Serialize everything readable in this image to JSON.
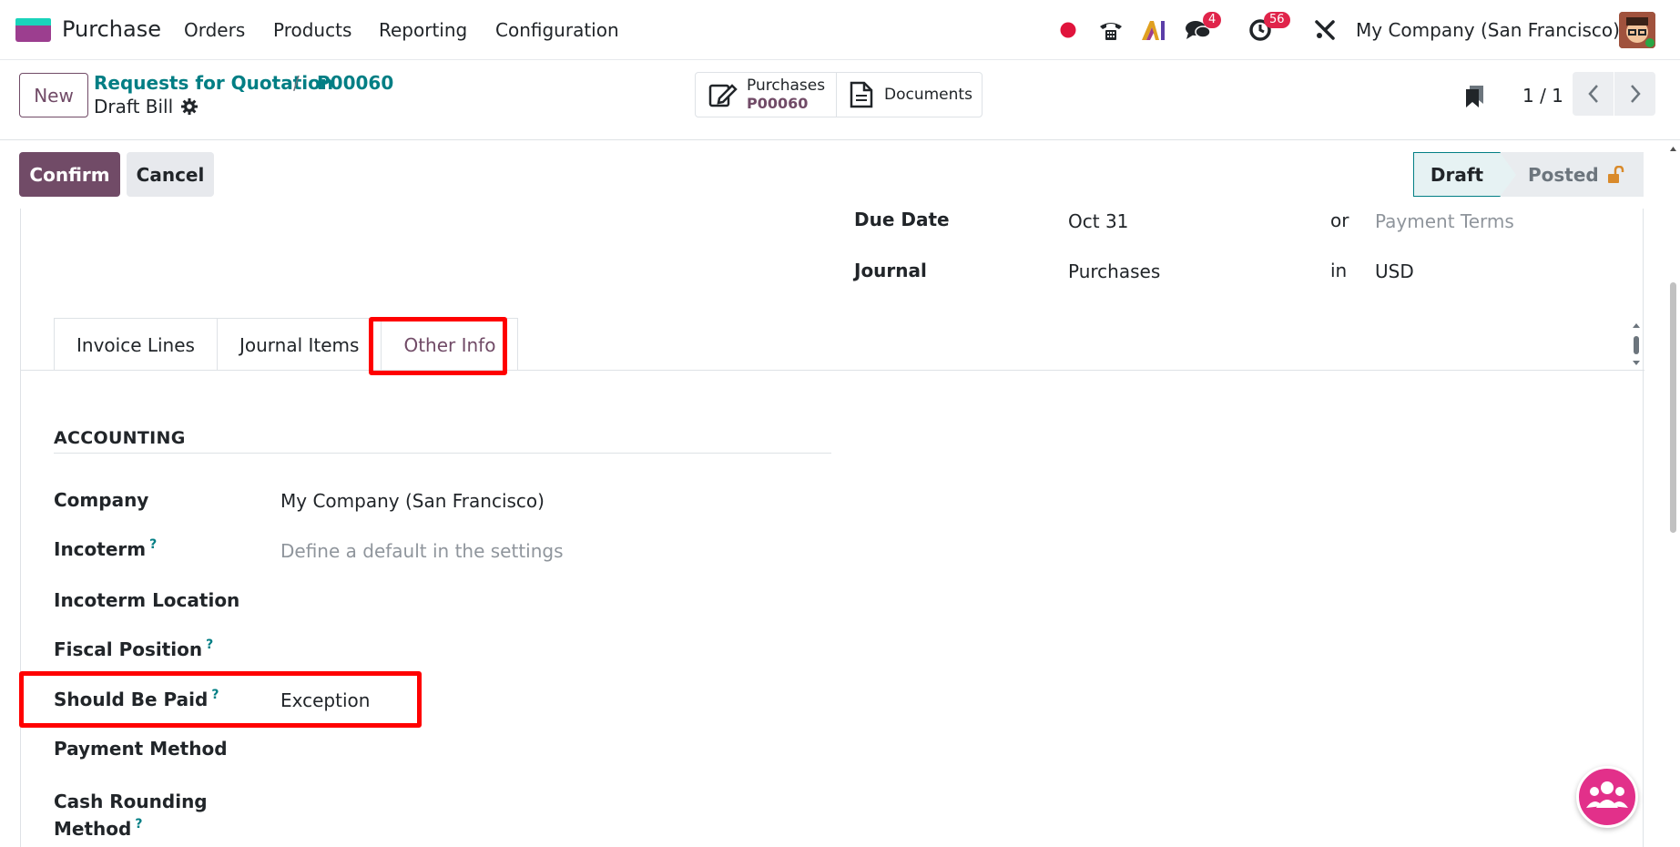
{
  "navbar": {
    "app_name": "Purchase",
    "menu": [
      "Orders",
      "Products",
      "Reporting",
      "Configuration"
    ],
    "messages_badge": "4",
    "activities_badge": "56",
    "company": "My Company (San Francisco)"
  },
  "control": {
    "new_label": "New",
    "breadcrumb_parent": "Requests for Quotation",
    "breadcrumb_separator": "/",
    "breadcrumb_current": "P00060",
    "record_name": "Draft Bill",
    "smart_purchases_label": "Purchases",
    "smart_purchases_value": "P00060",
    "smart_documents_label": "Documents",
    "pager": "1 / 1"
  },
  "statusbar": {
    "confirm_label": "Confirm",
    "cancel_label": "Cancel",
    "state_draft": "Draft",
    "state_posted": "Posted"
  },
  "header_fields": {
    "due_date_label": "Due Date",
    "due_date_value": "Oct 31",
    "due_date_or": "or",
    "payment_terms_placeholder": "Payment Terms",
    "journal_label": "Journal",
    "journal_value": "Purchases",
    "journal_in": "in",
    "currency": "USD"
  },
  "tabs": [
    "Invoice Lines",
    "Journal Items",
    "Other Info"
  ],
  "accounting": {
    "title": "ACCOUNTING",
    "company_label": "Company",
    "company_value": "My Company (San Francisco)",
    "incoterm_label": "Incoterm",
    "incoterm_placeholder": "Define a default in the settings",
    "incoterm_location_label": "Incoterm Location",
    "fiscal_position_label": "Fiscal Position",
    "should_be_paid_label": "Should Be Paid",
    "should_be_paid_value": "Exception",
    "payment_method_label": "Payment Method",
    "cash_rounding_label_1": "Cash Rounding",
    "cash_rounding_label_2": "Method",
    "help_mark": "?"
  },
  "colors": {
    "brand": "#714b67",
    "link": "#017e84",
    "highlight": "#ff0000"
  }
}
